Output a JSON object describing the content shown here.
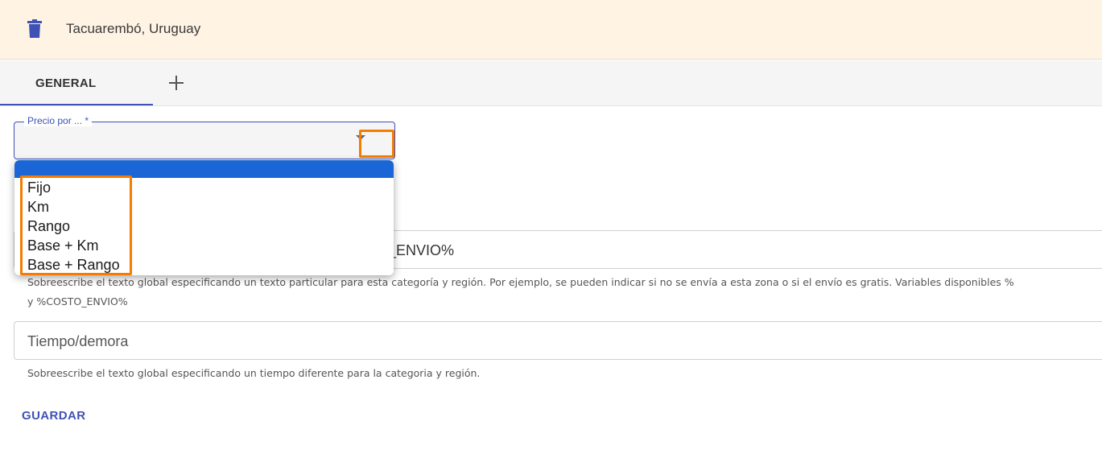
{
  "header": {
    "title": "Tacuarembó, Uruguay",
    "delete_icon": "trash-icon"
  },
  "tabs": {
    "items": [
      {
        "label": "GENERAL",
        "active": true
      }
    ],
    "add_icon": "plus-icon"
  },
  "form": {
    "price_select": {
      "label": "Precio por ... *",
      "value": "",
      "options": [
        "",
        "Fijo",
        "Km",
        "Rango",
        "Base + Km",
        "Base + Rango"
      ],
      "highlighted_option": 0
    },
    "message_field": {
      "visible_value": "_ENVIO%",
      "hint_line1": "Sobreescribe el texto global especificando un texto particular para esta categoría y región. Por ejemplo, se pueden indicar si no se envía a esta zona o si el envío es gratis. Variables disponibles %",
      "hint_line2": "y %COSTO_ENVIO%"
    },
    "time_field": {
      "placeholder": "Tiempo/demora",
      "hint": "Sobreescribe el texto global especificando un tiempo diferente para la categoria y región."
    },
    "save_label": "GUARDAR"
  },
  "colors": {
    "header_bg": "#fff3e4",
    "accent": "#3f51b5",
    "dropdown_selected": "#1a66d6",
    "highlight_box": "#f57c00"
  }
}
